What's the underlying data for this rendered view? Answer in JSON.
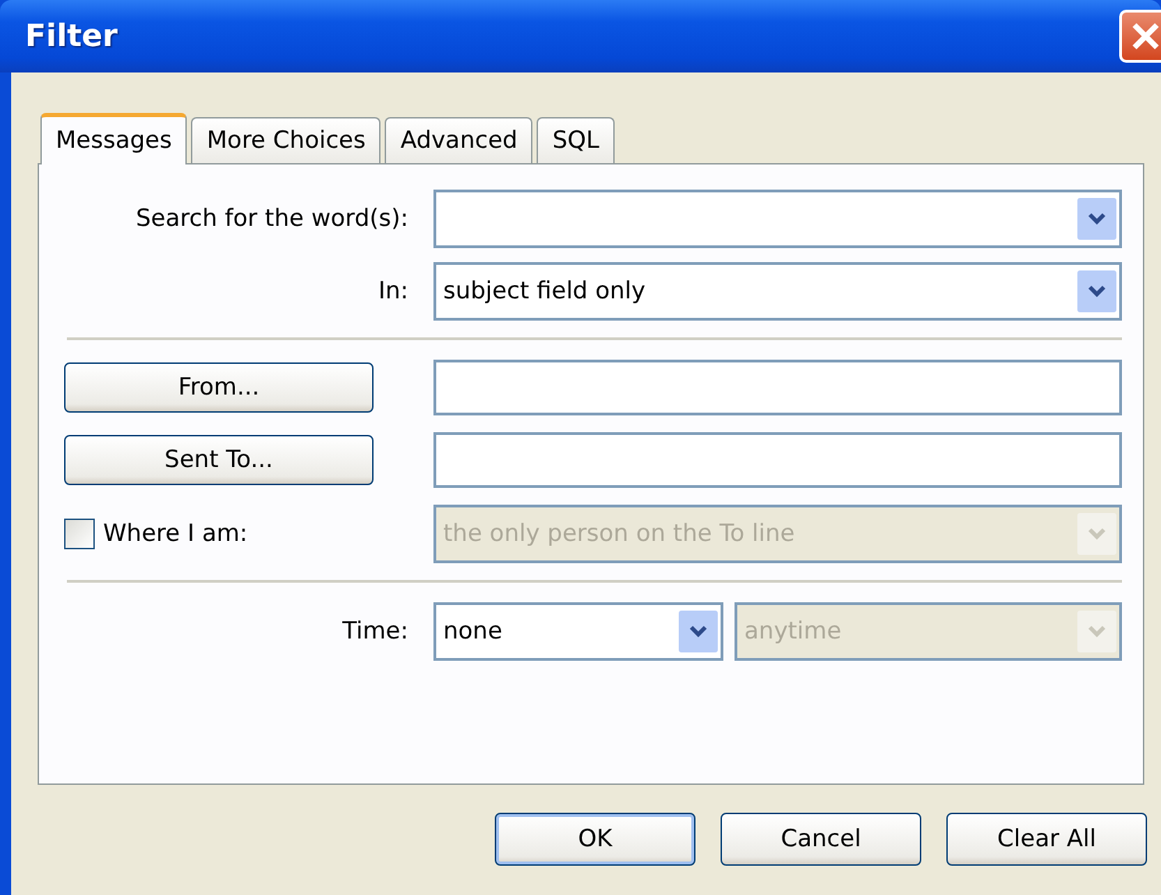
{
  "window": {
    "title": "Filter"
  },
  "tabs": [
    {
      "label": "Messages",
      "selected": true
    },
    {
      "label": "More Choices",
      "selected": false
    },
    {
      "label": "Advanced",
      "selected": false
    },
    {
      "label": "SQL",
      "selected": false
    }
  ],
  "search": {
    "label": "Search for the word(s):"
  },
  "in": {
    "label": "In:",
    "value": "subject field only"
  },
  "from": {
    "button": "From..."
  },
  "sent_to": {
    "button": "Sent To..."
  },
  "where_i_am": {
    "label": "Where I am:",
    "checked": false,
    "value": "the only person on the To line",
    "disabled": true
  },
  "time": {
    "label": "Time:",
    "value": "none",
    "disabled": false,
    "range": {
      "value": "anytime",
      "disabled": true
    }
  },
  "buttons": [
    {
      "label": "OK",
      "default": true
    },
    {
      "label": "Cancel",
      "default": false
    },
    {
      "label": "Clear All",
      "default": false
    }
  ]
}
